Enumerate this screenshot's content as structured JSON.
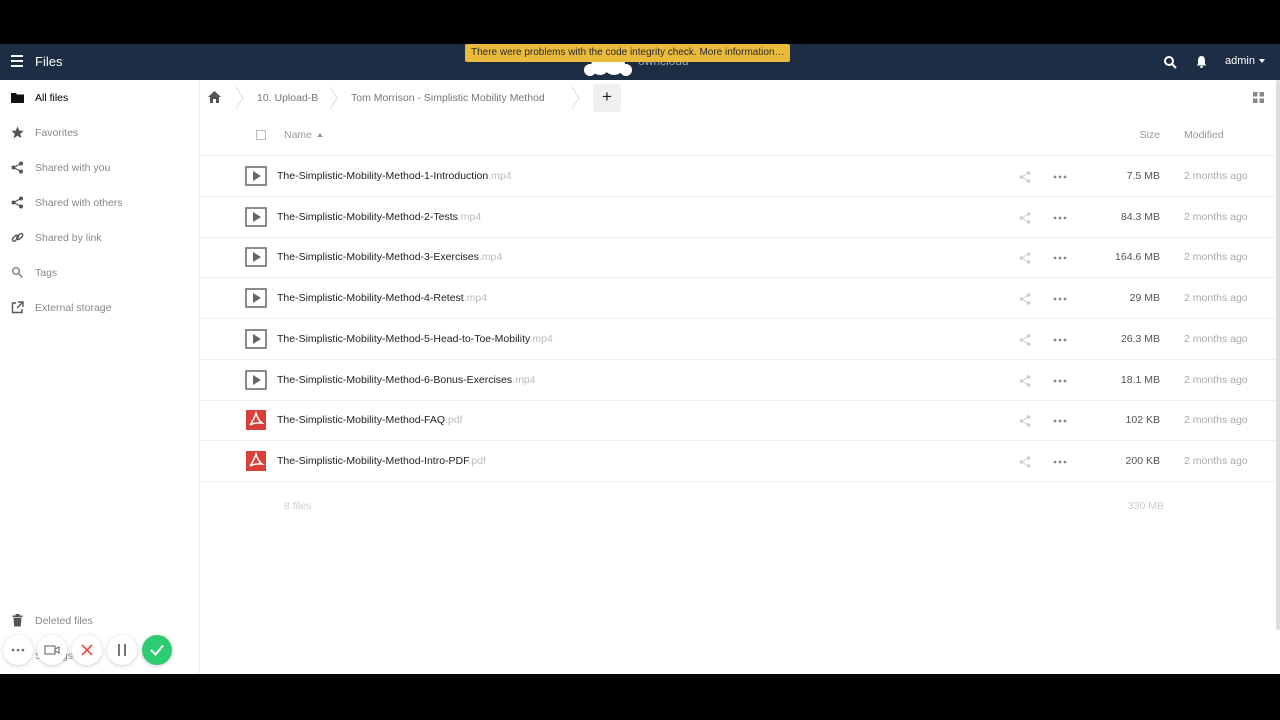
{
  "header": {
    "app_title": "Files",
    "logo_text": "owncloud",
    "warning": "There were problems with the code integrity check. More information…",
    "user": "admin",
    "bg_color": "#1d2d44",
    "warning_color": "#eaba3a"
  },
  "sidebar": {
    "items": [
      {
        "label": "All files",
        "icon": "folder-icon"
      },
      {
        "label": "Favorites",
        "icon": "star-icon"
      },
      {
        "label": "Shared with you",
        "icon": "share-icon"
      },
      {
        "label": "Shared with others",
        "icon": "share-icon"
      },
      {
        "label": "Shared by link",
        "icon": "link-icon"
      },
      {
        "label": "Tags",
        "icon": "tag-search-icon"
      },
      {
        "label": "External storage",
        "icon": "external-link-icon"
      }
    ],
    "deleted_files": "Deleted files",
    "settings": "Settings"
  },
  "breadcrumb": {
    "items": [
      "10. Upload-B",
      "Tom Morrison - Simplistic Mobility Method"
    ],
    "add_label": "+"
  },
  "table": {
    "col_name": "Name",
    "col_size": "Size",
    "col_modified": "Modified",
    "rows": [
      {
        "name": "The-Simplistic-Mobility-Method-1-Introduction",
        "ext": ".mp4",
        "type": "video-icon",
        "size": "7.5 MB",
        "modified": "2 months ago"
      },
      {
        "name": "The-Simplistic-Mobility-Method-2-Tests",
        "ext": ".mp4",
        "type": "video-icon",
        "size": "84.3 MB",
        "modified": "2 months ago"
      },
      {
        "name": "The-Simplistic-Mobility-Method-3-Exercises",
        "ext": ".mp4",
        "type": "video-icon",
        "size": "164.6 MB",
        "modified": "2 months ago"
      },
      {
        "name": "The-Simplistic-Mobility-Method-4-Retest",
        "ext": ".mp4",
        "type": "video-icon",
        "size": "29 MB",
        "modified": "2 months ago"
      },
      {
        "name": "The-Simplistic-Mobility-Method-5-Head-to-Toe-Mobility",
        "ext": ".mp4",
        "type": "video-icon",
        "size": "26.3 MB",
        "modified": "2 months ago"
      },
      {
        "name": "The-Simplistic-Mobility-Method-6-Bonus-Exercises",
        "ext": ".mp4",
        "type": "video-icon",
        "size": "18.1 MB",
        "modified": "2 months ago"
      },
      {
        "name": "The-Simplistic-Mobility-Method-FAQ",
        "ext": ".pdf",
        "type": "pdf-icon",
        "size": "102 KB",
        "modified": "2 months ago"
      },
      {
        "name": "The-Simplistic-Mobility-Method-Intro-PDF",
        "ext": ".pdf",
        "type": "pdf-icon",
        "size": "200 KB",
        "modified": "2 months ago"
      }
    ],
    "summary_count": "8 files",
    "summary_size": "330 MB"
  },
  "recorder": {
    "accent_color": "#2ecc71",
    "close_color": "#e74c3c"
  }
}
